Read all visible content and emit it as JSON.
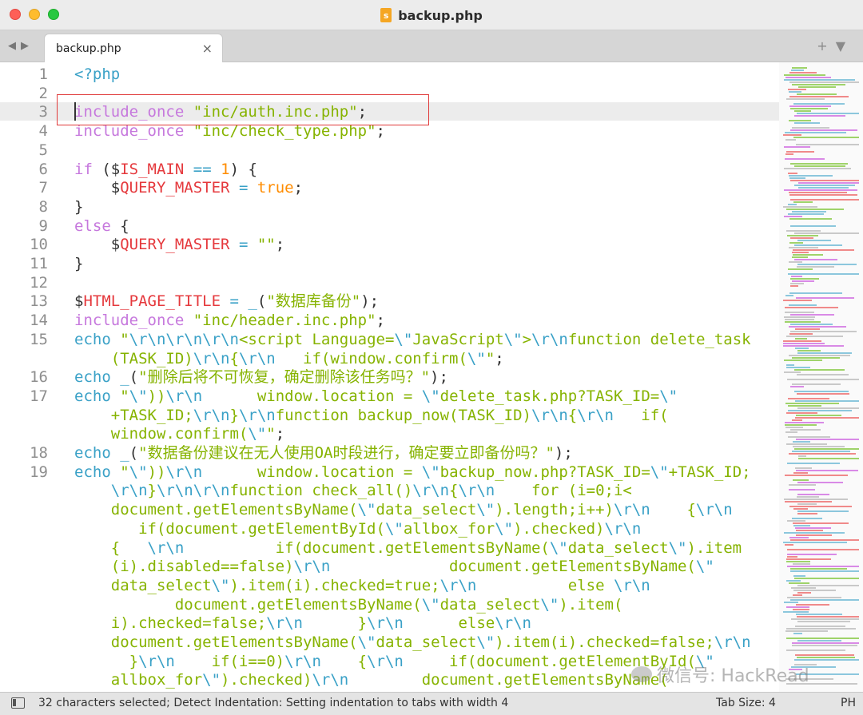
{
  "window": {
    "title": "backup.php"
  },
  "tabs": [
    {
      "label": "backup.php",
      "close": "×"
    }
  ],
  "nav": {
    "back": "◀",
    "forward": "▶",
    "new_tab": "+",
    "tab_menu": "▼"
  },
  "editor": {
    "lines": [
      {
        "n": "1",
        "segs": [
          [
            "o",
            "<?php"
          ]
        ]
      },
      {
        "n": "2",
        "segs": []
      },
      {
        "n": "3",
        "segs": [
          [
            "k",
            "include_once"
          ],
          [
            "p",
            " "
          ],
          [
            "s",
            "\"inc/auth.inc.php\""
          ],
          [
            "p",
            ";"
          ]
        ]
      },
      {
        "n": "4",
        "segs": [
          [
            "k",
            "include_once"
          ],
          [
            "p",
            " "
          ],
          [
            "s",
            "\"inc/check_type.php\""
          ],
          [
            "p",
            ";"
          ]
        ]
      },
      {
        "n": "5",
        "segs": []
      },
      {
        "n": "6",
        "segs": [
          [
            "k",
            "if"
          ],
          [
            "p",
            " ("
          ],
          [
            "p",
            "$"
          ],
          [
            "v",
            "IS_MAIN"
          ],
          [
            "p",
            " "
          ],
          [
            "o",
            "=="
          ],
          [
            "p",
            " "
          ],
          [
            "c",
            "1"
          ],
          [
            "p",
            ") {"
          ]
        ]
      },
      {
        "n": "7",
        "segs": [
          [
            "p",
            "    $"
          ],
          [
            "v",
            "QUERY_MASTER"
          ],
          [
            "p",
            " "
          ],
          [
            "o",
            "="
          ],
          [
            "p",
            " "
          ],
          [
            "c",
            "true"
          ],
          [
            "p",
            ";"
          ]
        ]
      },
      {
        "n": "8",
        "segs": [
          [
            "p",
            "}"
          ]
        ]
      },
      {
        "n": "9",
        "segs": [
          [
            "k",
            "else"
          ],
          [
            "p",
            " {"
          ]
        ]
      },
      {
        "n": "10",
        "segs": [
          [
            "p",
            "    $"
          ],
          [
            "v",
            "QUERY_MASTER"
          ],
          [
            "p",
            " "
          ],
          [
            "o",
            "="
          ],
          [
            "p",
            " "
          ],
          [
            "s",
            "\"\""
          ],
          [
            "p",
            ";"
          ]
        ]
      },
      {
        "n": "11",
        "segs": [
          [
            "p",
            "}"
          ]
        ]
      },
      {
        "n": "12",
        "segs": []
      },
      {
        "n": "13",
        "segs": [
          [
            "p",
            "$"
          ],
          [
            "v",
            "HTML_PAGE_TITLE"
          ],
          [
            "p",
            " "
          ],
          [
            "o",
            "="
          ],
          [
            "p",
            " "
          ],
          [
            "f",
            "_"
          ],
          [
            "p",
            "("
          ],
          [
            "s",
            "\"数据库备份\""
          ],
          [
            "p",
            ");"
          ]
        ]
      },
      {
        "n": "14",
        "segs": [
          [
            "k",
            "include_once"
          ],
          [
            "p",
            " "
          ],
          [
            "s",
            "\"inc/header.inc.php\""
          ],
          [
            "p",
            ";"
          ]
        ]
      },
      {
        "n": "15",
        "segs": [
          [
            "f",
            "echo"
          ],
          [
            "p",
            " "
          ],
          [
            "s",
            "\""
          ],
          [
            "f",
            "\\r\\n\\r\\n\\r\\n"
          ],
          [
            "s",
            "<script Language="
          ],
          [
            "f",
            "\\\""
          ],
          [
            "s",
            "JavaScript"
          ],
          [
            "f",
            "\\\""
          ],
          [
            "s",
            ">"
          ],
          [
            "f",
            "\\r\\n"
          ],
          [
            "s",
            "function delete_task"
          ]
        ]
      },
      {
        "n": "",
        "segs": [
          [
            "s",
            "    (TASK_ID)"
          ],
          [
            "f",
            "\\r\\n"
          ],
          [
            "s",
            "{"
          ],
          [
            "f",
            "\\r\\n"
          ],
          [
            "s",
            "   if(window.confirm("
          ],
          [
            "f",
            "\\\""
          ],
          [
            "s",
            "\""
          ],
          [
            "p",
            ";"
          ]
        ]
      },
      {
        "n": "16",
        "segs": [
          [
            "f",
            "echo"
          ],
          [
            "p",
            " "
          ],
          [
            "f",
            "_"
          ],
          [
            "p",
            "("
          ],
          [
            "s",
            "\"删除后将不可恢复，确定删除该任务吗？\""
          ],
          [
            "p",
            ");"
          ]
        ]
      },
      {
        "n": "17",
        "segs": [
          [
            "f",
            "echo"
          ],
          [
            "p",
            " "
          ],
          [
            "s",
            "\""
          ],
          [
            "f",
            "\\\""
          ],
          [
            "s",
            "))"
          ],
          [
            "f",
            "\\r\\n"
          ],
          [
            "s",
            "      window.location = "
          ],
          [
            "f",
            "\\\""
          ],
          [
            "s",
            "delete_task.php?TASK_ID="
          ],
          [
            "f",
            "\\\""
          ]
        ]
      },
      {
        "n": "",
        "segs": [
          [
            "s",
            "    +TASK_ID;"
          ],
          [
            "f",
            "\\r\\n"
          ],
          [
            "s",
            "}"
          ],
          [
            "f",
            "\\r\\n"
          ],
          [
            "s",
            "function backup_now(TASK_ID)"
          ],
          [
            "f",
            "\\r\\n"
          ],
          [
            "s",
            "{"
          ],
          [
            "f",
            "\\r\\n"
          ],
          [
            "s",
            "   if("
          ]
        ]
      },
      {
        "n": "",
        "segs": [
          [
            "s",
            "    window.confirm("
          ],
          [
            "f",
            "\\\""
          ],
          [
            "s",
            "\""
          ],
          [
            "p",
            ";"
          ]
        ]
      },
      {
        "n": "18",
        "segs": [
          [
            "f",
            "echo"
          ],
          [
            "p",
            " "
          ],
          [
            "f",
            "_"
          ],
          [
            "p",
            "("
          ],
          [
            "s",
            "\"数据备份建议在无人使用OA时段进行，确定要立即备份吗？\""
          ],
          [
            "p",
            ");"
          ]
        ]
      },
      {
        "n": "19",
        "segs": [
          [
            "f",
            "echo"
          ],
          [
            "p",
            " "
          ],
          [
            "s",
            "\""
          ],
          [
            "f",
            "\\\""
          ],
          [
            "s",
            "))"
          ],
          [
            "f",
            "\\r\\n"
          ],
          [
            "s",
            "      window.location = "
          ],
          [
            "f",
            "\\\""
          ],
          [
            "s",
            "backup_now.php?TASK_ID="
          ],
          [
            "f",
            "\\\""
          ],
          [
            "s",
            "+TASK_ID;"
          ]
        ]
      },
      {
        "n": "",
        "segs": [
          [
            "f",
            "    \\r\\n"
          ],
          [
            "s",
            "}"
          ],
          [
            "f",
            "\\r\\n\\r\\n"
          ],
          [
            "s",
            "function check_all()"
          ],
          [
            "f",
            "\\r\\n"
          ],
          [
            "s",
            "{"
          ],
          [
            "f",
            "\\r\\n"
          ],
          [
            "s",
            "    for (i=0;i<"
          ]
        ]
      },
      {
        "n": "",
        "segs": [
          [
            "s",
            "    document.getElementsByName("
          ],
          [
            "f",
            "\\\""
          ],
          [
            "s",
            "data_select"
          ],
          [
            "f",
            "\\\""
          ],
          [
            "s",
            ").length;i++)"
          ],
          [
            "f",
            "\\r\\n"
          ],
          [
            "s",
            "    {"
          ],
          [
            "f",
            "\\r\\n"
          ]
        ]
      },
      {
        "n": "",
        "segs": [
          [
            "s",
            "       if(document.getElementById("
          ],
          [
            "f",
            "\\\""
          ],
          [
            "s",
            "allbox_for"
          ],
          [
            "f",
            "\\\""
          ],
          [
            "s",
            ").checked)"
          ],
          [
            "f",
            "\\r\\n"
          ]
        ]
      },
      {
        "n": "",
        "segs": [
          [
            "s",
            "    {   "
          ],
          [
            "f",
            "\\r\\n"
          ],
          [
            "s",
            "          if(document.getElementsByName("
          ],
          [
            "f",
            "\\\""
          ],
          [
            "s",
            "data_select"
          ],
          [
            "f",
            "\\\""
          ],
          [
            "s",
            ").item"
          ]
        ]
      },
      {
        "n": "",
        "segs": [
          [
            "s",
            "    (i).disabled==false)"
          ],
          [
            "f",
            "\\r\\n"
          ],
          [
            "s",
            "             document.getElementsByName("
          ],
          [
            "f",
            "\\\""
          ]
        ]
      },
      {
        "n": "",
        "segs": [
          [
            "s",
            "    data_select"
          ],
          [
            "f",
            "\\\""
          ],
          [
            "s",
            ").item(i).checked=true;"
          ],
          [
            "f",
            "\\r\\n"
          ],
          [
            "s",
            "          else "
          ],
          [
            "f",
            "\\r\\n"
          ]
        ]
      },
      {
        "n": "",
        "segs": [
          [
            "s",
            "           document.getElementsByName("
          ],
          [
            "f",
            "\\\""
          ],
          [
            "s",
            "data_select"
          ],
          [
            "f",
            "\\\""
          ],
          [
            "s",
            ").item("
          ]
        ]
      },
      {
        "n": "",
        "segs": [
          [
            "s",
            "    i).checked=false;"
          ],
          [
            "f",
            "\\r\\n"
          ],
          [
            "s",
            "      }"
          ],
          [
            "f",
            "\\r\\n"
          ],
          [
            "s",
            "      else"
          ],
          [
            "f",
            "\\r\\n"
          ]
        ]
      },
      {
        "n": "",
        "segs": [
          [
            "s",
            "    document.getElementsByName("
          ],
          [
            "f",
            "\\\""
          ],
          [
            "s",
            "data_select"
          ],
          [
            "f",
            "\\\""
          ],
          [
            "s",
            ").item(i).checked=false;"
          ],
          [
            "f",
            "\\r\\n"
          ]
        ]
      },
      {
        "n": "",
        "segs": [
          [
            "s",
            "      }"
          ],
          [
            "f",
            "\\r\\n"
          ],
          [
            "s",
            "    if(i==0)"
          ],
          [
            "f",
            "\\r\\n"
          ],
          [
            "s",
            "    {"
          ],
          [
            "f",
            "\\r\\n"
          ],
          [
            "s",
            "     if(document.getElementById("
          ],
          [
            "f",
            "\\\""
          ]
        ]
      },
      {
        "n": "",
        "segs": [
          [
            "s",
            "    allbox_for"
          ],
          [
            "f",
            "\\\""
          ],
          [
            "s",
            ").checked)"
          ],
          [
            "f",
            "\\r\\n"
          ],
          [
            "s",
            "        document.getElementsByName("
          ]
        ]
      }
    ]
  },
  "status": {
    "message": "32 characters selected; Detect Indentation: Setting indentation to tabs with width 4",
    "tab_size": "Tab Size: 4",
    "syntax": "PH"
  },
  "watermark": {
    "text": "微信号: HackRead"
  },
  "colors": {
    "selection_box": "#e03b3b",
    "keyword": "#c678dd",
    "string": "#86b300",
    "variable": "#e5393d",
    "operator": "#3aa1c7"
  }
}
